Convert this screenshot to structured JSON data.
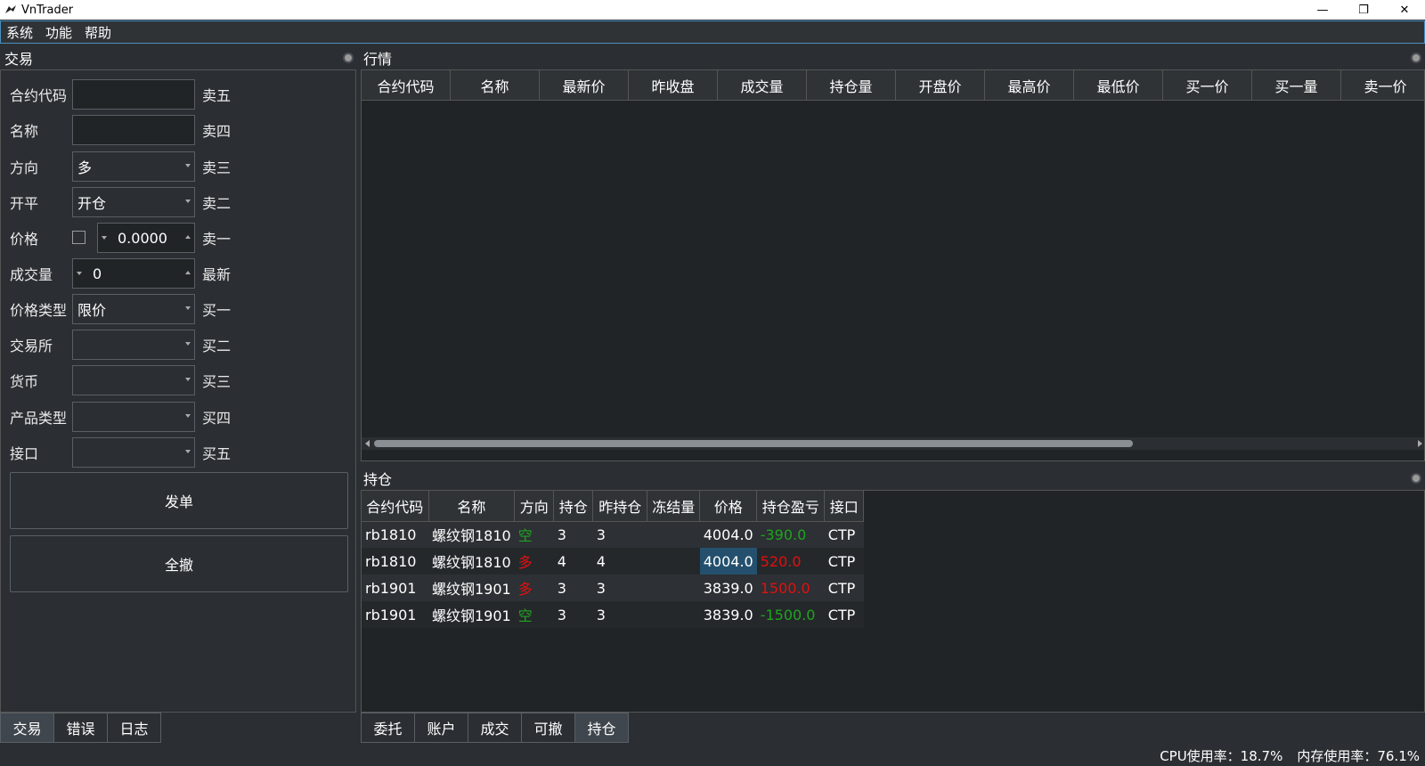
{
  "window": {
    "title": "VnTrader",
    "minimize": "—",
    "restore": "❐",
    "close": "✕"
  },
  "menu": [
    "系统",
    "功能",
    "帮助"
  ],
  "trade_panel": {
    "title": "交易",
    "fields": {
      "symbol": {
        "label": "合约代码",
        "value": "",
        "side": "卖五"
      },
      "name": {
        "label": "名称",
        "value": "",
        "side": "卖四"
      },
      "direction": {
        "label": "方向",
        "value": "多",
        "side": "卖三"
      },
      "offset": {
        "label": "开平",
        "value": "开仓",
        "side": "卖二"
      },
      "price": {
        "label": "价格",
        "value": "0.0000",
        "side": "卖一"
      },
      "volume": {
        "label": "成交量",
        "value": "0",
        "side": "最新"
      },
      "price_type": {
        "label": "价格类型",
        "value": "限价",
        "side": "买一"
      },
      "exchange": {
        "label": "交易所",
        "value": "",
        "side": "买二"
      },
      "currency": {
        "label": "货币",
        "value": "",
        "side": "买三"
      },
      "product": {
        "label": "产品类型",
        "value": "",
        "side": "买四"
      },
      "gateway": {
        "label": "接口",
        "value": "",
        "side": "买五"
      }
    },
    "send_button": "发单",
    "cancel_all_button": "全撤"
  },
  "left_tabs": [
    {
      "label": "交易",
      "active": true
    },
    {
      "label": "错误",
      "active": false
    },
    {
      "label": "日志",
      "active": false
    }
  ],
  "market_panel": {
    "title": "行情",
    "columns": [
      "合约代码",
      "名称",
      "最新价",
      "昨收盘",
      "成交量",
      "持仓量",
      "开盘价",
      "最高价",
      "最低价",
      "买一价",
      "买一量",
      "卖一价"
    ]
  },
  "position_panel": {
    "title": "持仓",
    "columns": [
      "合约代码",
      "名称",
      "方向",
      "持仓",
      "昨持仓",
      "冻结量",
      "价格",
      "持仓盈亏",
      "接口"
    ],
    "rows": [
      {
        "symbol": "rb1810",
        "name": "螺纹钢1810",
        "direction": "空",
        "position": "3",
        "yd_position": "3",
        "frozen": "",
        "price": "4004.0",
        "pnl": "-390.0",
        "gateway": "CTP",
        "dir_color": "green",
        "pnl_color": "green"
      },
      {
        "symbol": "rb1810",
        "name": "螺纹钢1810",
        "direction": "多",
        "position": "4",
        "yd_position": "4",
        "frozen": "",
        "price": "4004.0",
        "pnl": "520.0",
        "gateway": "CTP",
        "dir_color": "red",
        "pnl_color": "red"
      },
      {
        "symbol": "rb1901",
        "name": "螺纹钢1901",
        "direction": "多",
        "position": "3",
        "yd_position": "3",
        "frozen": "",
        "price": "3839.0",
        "pnl": "1500.0",
        "gateway": "CTP",
        "dir_color": "red",
        "pnl_color": "red"
      },
      {
        "symbol": "rb1901",
        "name": "螺纹钢1901",
        "direction": "空",
        "position": "3",
        "yd_position": "3",
        "frozen": "",
        "price": "3839.0",
        "pnl": "-1500.0",
        "gateway": "CTP",
        "dir_color": "green",
        "pnl_color": "green"
      }
    ]
  },
  "bottom_tabs": [
    {
      "label": "委托",
      "active": false
    },
    {
      "label": "账户",
      "active": false
    },
    {
      "label": "成交",
      "active": false
    },
    {
      "label": "可撤",
      "active": false
    },
    {
      "label": "持仓",
      "active": true
    }
  ],
  "status": {
    "cpu": "CPU使用率：18.7%",
    "mem": "内存使用率：76.1%"
  }
}
